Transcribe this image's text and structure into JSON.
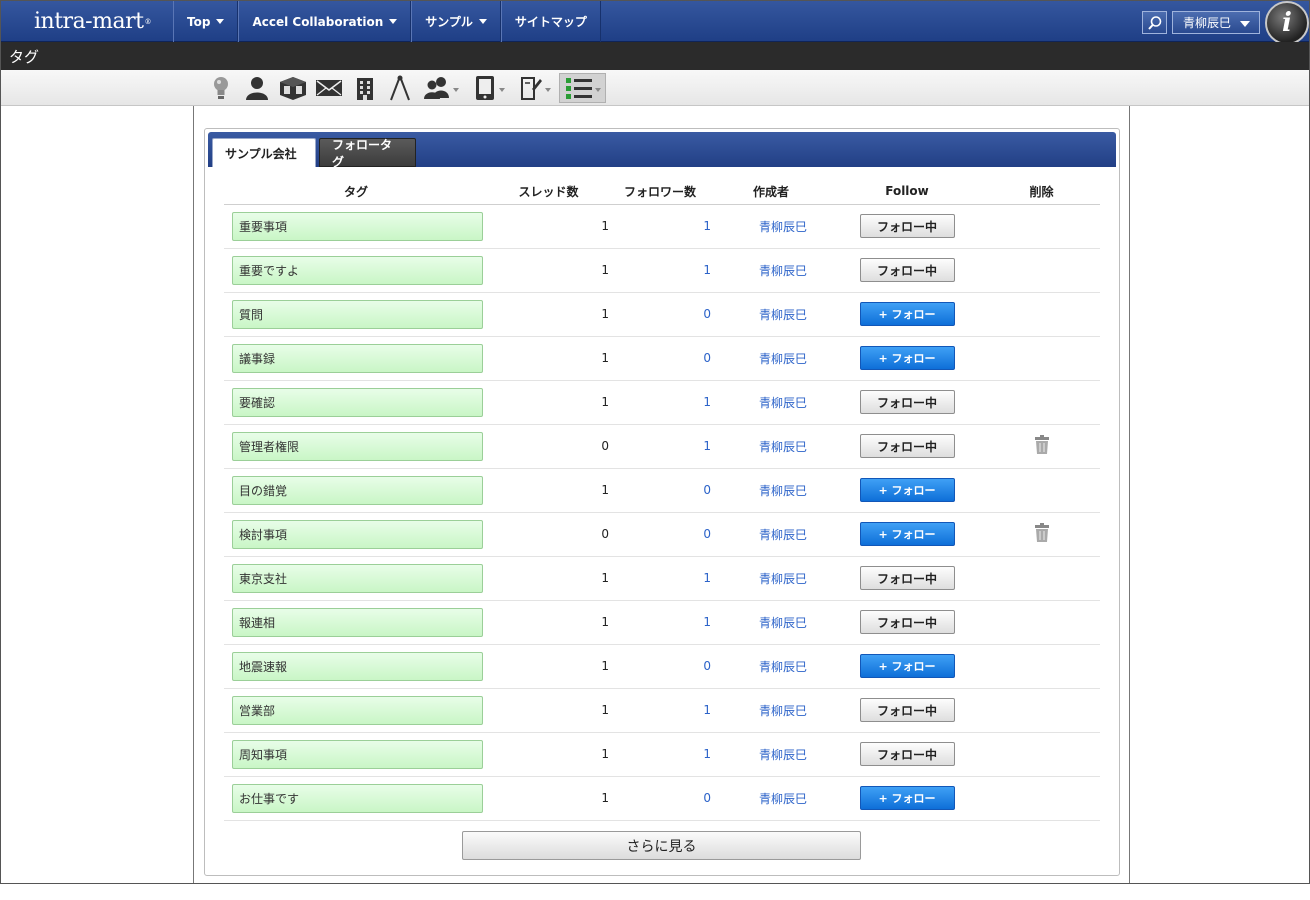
{
  "header": {
    "logo_text": "intra-mart",
    "nav": [
      {
        "label": "Top",
        "has_caret": true
      },
      {
        "label": "Accel Collaboration",
        "has_caret": true
      },
      {
        "label": "サンプル",
        "has_caret": true
      },
      {
        "label": "サイトマップ",
        "has_caret": false
      }
    ],
    "user_name": "青柳辰巳",
    "search_icon": "search-icon",
    "info_icon": "info-icon"
  },
  "page": {
    "title": "タグ"
  },
  "toolbar": {
    "icons": [
      "lightbulb-icon",
      "user-icon",
      "box-icon",
      "mail-icon",
      "building-icon",
      "compass-icon",
      "users-icon",
      "phone-icon",
      "document-pen-icon",
      "checklist-icon"
    ],
    "active_icon": "checklist-icon"
  },
  "tabs": [
    {
      "label": "サンプル会社",
      "active": true
    },
    {
      "label": "フォロータグ",
      "active": false
    }
  ],
  "table": {
    "headers": {
      "tag": "タグ",
      "threads": "スレッド数",
      "followers": "フォロワー数",
      "creator": "作成者",
      "follow": "Follow",
      "delete": "削除"
    },
    "rows": [
      {
        "tag": "重要事項",
        "threads": "1",
        "followers": "1",
        "creator": "青柳辰巳",
        "following": true,
        "deletable": false
      },
      {
        "tag": "重要ですよ",
        "threads": "1",
        "followers": "1",
        "creator": "青柳辰巳",
        "following": true,
        "deletable": false
      },
      {
        "tag": "質問",
        "threads": "1",
        "followers": "0",
        "creator": "青柳辰巳",
        "following": false,
        "deletable": false
      },
      {
        "tag": "議事録",
        "threads": "1",
        "followers": "0",
        "creator": "青柳辰巳",
        "following": false,
        "deletable": false
      },
      {
        "tag": "要確認",
        "threads": "1",
        "followers": "1",
        "creator": "青柳辰巳",
        "following": true,
        "deletable": false
      },
      {
        "tag": "管理者権限",
        "threads": "0",
        "followers": "1",
        "creator": "青柳辰巳",
        "following": true,
        "deletable": true
      },
      {
        "tag": "目の錯覚",
        "threads": "1",
        "followers": "0",
        "creator": "青柳辰巳",
        "following": false,
        "deletable": false
      },
      {
        "tag": "検討事項",
        "threads": "0",
        "followers": "0",
        "creator": "青柳辰巳",
        "following": false,
        "deletable": true
      },
      {
        "tag": "東京支社",
        "threads": "1",
        "followers": "1",
        "creator": "青柳辰巳",
        "following": true,
        "deletable": false
      },
      {
        "tag": "報連相",
        "threads": "1",
        "followers": "1",
        "creator": "青柳辰巳",
        "following": true,
        "deletable": false
      },
      {
        "tag": "地震速報",
        "threads": "1",
        "followers": "0",
        "creator": "青柳辰巳",
        "following": false,
        "deletable": false
      },
      {
        "tag": "営業部",
        "threads": "1",
        "followers": "1",
        "creator": "青柳辰巳",
        "following": true,
        "deletable": false
      },
      {
        "tag": "周知事項",
        "threads": "1",
        "followers": "1",
        "creator": "青柳辰巳",
        "following": true,
        "deletable": false
      },
      {
        "tag": "お仕事です",
        "threads": "1",
        "followers": "0",
        "creator": "青柳辰巳",
        "following": false,
        "deletable": false
      }
    ]
  },
  "labels": {
    "following": "フォロー中",
    "follow": "+ フォロー",
    "more": "さらに見る"
  },
  "colors": {
    "nav_blue": "#223f85",
    "tag_green": "#c9f6c6",
    "follow_blue": "#0e6fd8",
    "link_blue": "#2c63c9"
  }
}
